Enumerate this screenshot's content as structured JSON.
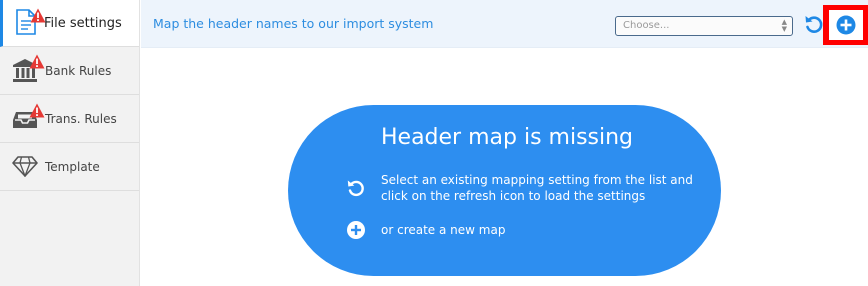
{
  "sidebar": {
    "items": [
      {
        "label": "File settings",
        "icon": "document-icon",
        "warning": true,
        "active": true
      },
      {
        "label": "Bank Rules",
        "icon": "bank-icon",
        "warning": true,
        "active": false
      },
      {
        "label": "Trans. Rules",
        "icon": "inbox-tray-icon",
        "warning": true,
        "active": false
      },
      {
        "label": "Template",
        "icon": "diamond-icon",
        "warning": false,
        "active": false
      }
    ]
  },
  "header": {
    "title": "Map the header names to our import system",
    "select_placeholder": "Choose...",
    "refresh_icon": "refresh-icon",
    "add_icon": "plus-circle-icon"
  },
  "main": {
    "title": "Header map is missing",
    "instruction_select": "Select an existing mapping setting from the list and click on the refresh icon to load the settings",
    "instruction_create": "or create a new map"
  },
  "colors": {
    "accent": "#2d8ef0",
    "warning": "#e53935",
    "highlight": "#ff0000"
  }
}
